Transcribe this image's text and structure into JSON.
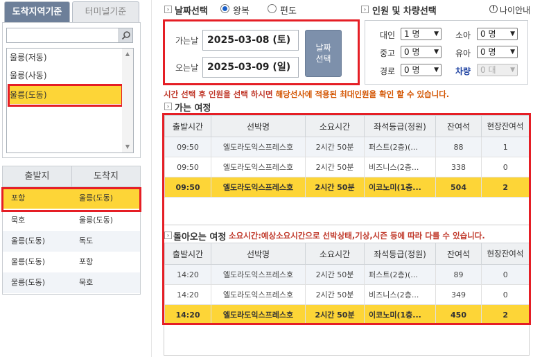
{
  "left": {
    "tabs": {
      "active": "도착지역기준",
      "inactive": "터미널기준"
    },
    "destinations": [
      "울릉(저동)",
      "울릉(사동)",
      "울릉(도동)"
    ],
    "route_header": {
      "from": "출발지",
      "to": "도착지"
    },
    "routes": [
      {
        "from": "포항",
        "to": "울릉(도동)"
      },
      {
        "from": "묵호",
        "to": "울릉(도동)"
      },
      {
        "from": "울릉(도동)",
        "to": "독도"
      },
      {
        "from": "울릉(도동)",
        "to": "포항"
      },
      {
        "from": "울릉(도동)",
        "to": "묵호"
      }
    ]
  },
  "top": {
    "date_select": "날짜선택",
    "round_trip": "왕복",
    "one_way": "편도",
    "people_select": "인원 및 차량선택",
    "age_info": "나이안내"
  },
  "dates": {
    "depart_label": "가는날",
    "depart_value": "2025-03-08 (토)",
    "return_label": "오는날",
    "return_value": "2025-03-09 (일)",
    "select_btn_line1": "날짜",
    "select_btn_line2": "선택"
  },
  "people": {
    "adult_label": "대인",
    "adult_value": "1 명",
    "child_label": "소아",
    "child_value": "0 명",
    "teen_label": "중고",
    "teen_value": "0 명",
    "infant_label": "유아",
    "infant_value": "0 명",
    "senior_label": "경로",
    "senior_value": "0 명",
    "vehicle_label": "차량",
    "vehicle_value": "0 대"
  },
  "notice": {
    "part1": "시간 선택 후 인원을 선택 하시면",
    "part2": "해당선사에 적용된 최대인원을 확인 할 수 있습니다."
  },
  "outbound": {
    "title": "가는 여정",
    "columns": [
      "출발시간",
      "선박명",
      "소요시간",
      "좌석등급(정원)",
      "잔여석",
      "현장잔여석"
    ],
    "rows": [
      {
        "time": "09:50",
        "ship": "엘도라도익스프레스호",
        "duration": "2시간 50분",
        "seat": "퍼스트(2층)(...",
        "remain": "88",
        "onsite": "1"
      },
      {
        "time": "09:50",
        "ship": "엘도라도익스프레스호",
        "duration": "2시간 50분",
        "seat": "비즈니스(2층...",
        "remain": "338",
        "onsite": "0"
      },
      {
        "time": "09:50",
        "ship": "엘도라도익스프레스호",
        "duration": "2시간 50분",
        "seat": "이코노미(1층...",
        "remain": "504",
        "onsite": "2"
      }
    ]
  },
  "return": {
    "title": "돌아오는 여정",
    "note": "소요시간:예상소요시간으로 선박상태,기상,시즌 등에 따라 다를 수 있습니다.",
    "columns": [
      "출발시간",
      "선박명",
      "소요시간",
      "좌석등급(정원)",
      "잔여석",
      "현장잔여석"
    ],
    "rows": [
      {
        "time": "14:20",
        "ship": "엘도라도익스프레스호",
        "duration": "2시간 50분",
        "seat": "퍼스트(2층)(...",
        "remain": "89",
        "onsite": "0"
      },
      {
        "time": "14:20",
        "ship": "엘도라도익스프레스호",
        "duration": "2시간 50분",
        "seat": "비즈니스(2층...",
        "remain": "349",
        "onsite": "0"
      },
      {
        "time": "14:20",
        "ship": "엘도라도익스프레스호",
        "duration": "2시간 50분",
        "seat": "이코노미(1층...",
        "remain": "450",
        "onsite": "2"
      }
    ]
  },
  "colors": {
    "highlight": "#fdd537",
    "accent_red": "#e51e25",
    "tab_active": "#6d7f99"
  }
}
